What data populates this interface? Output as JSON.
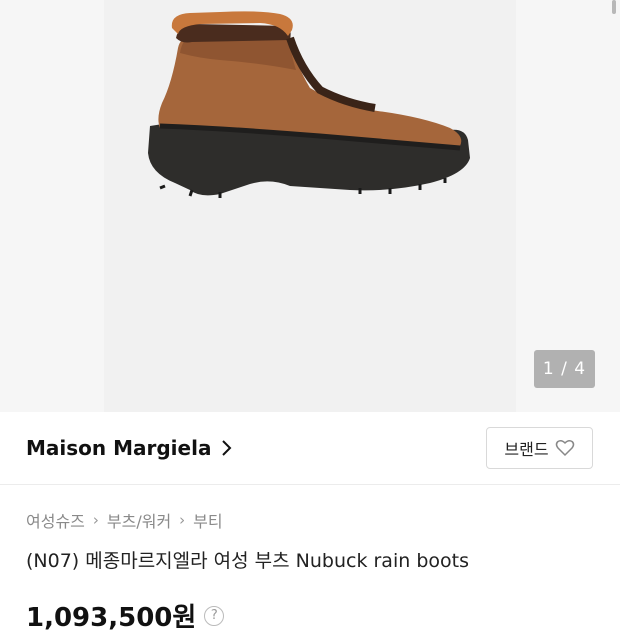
{
  "gallery": {
    "counter": "1 / 4",
    "image_alt": "brown nubuck ankle boot with shearling collar and black lug sole"
  },
  "brand": {
    "name": "Maison Margiela",
    "button_label": "브랜드"
  },
  "breadcrumb": {
    "items": [
      "여성슈즈",
      "부츠/워커",
      "부티"
    ]
  },
  "product": {
    "title": "(N07) 메종마르지엘라 여성 부츠 Nubuck rain boots",
    "price": "1,093,500원"
  },
  "icons": {
    "brand_chevron": "chevron-right-icon",
    "heart": "heart-icon",
    "help": "question-icon"
  }
}
